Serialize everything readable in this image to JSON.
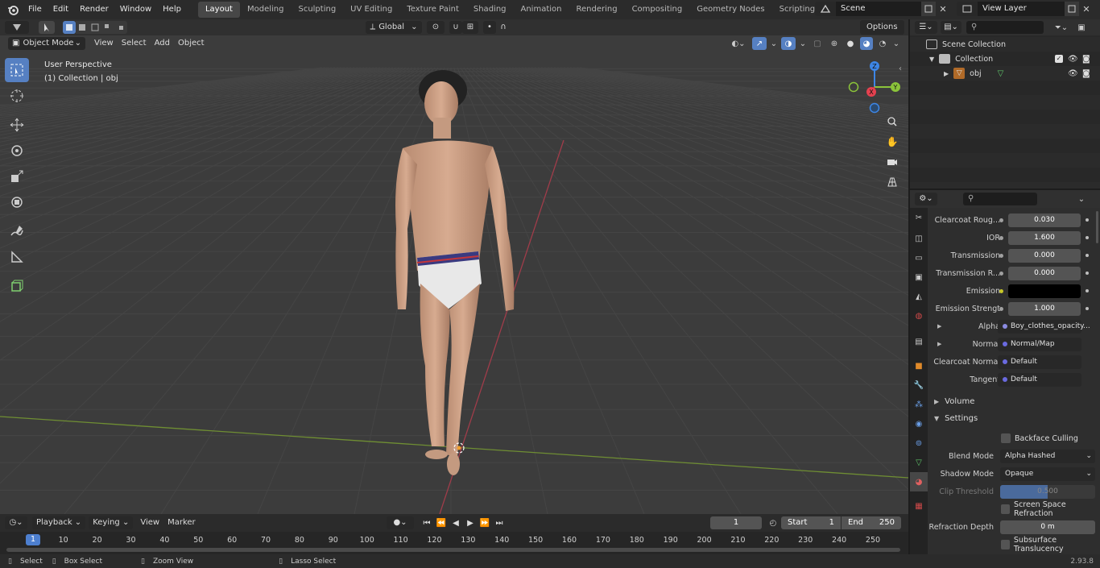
{
  "topbar": {
    "menus": [
      "File",
      "Edit",
      "Render",
      "Window",
      "Help"
    ],
    "workspaces": [
      "Layout",
      "Modeling",
      "Sculpting",
      "UV Editing",
      "Texture Paint",
      "Shading",
      "Animation",
      "Rendering",
      "Compositing",
      "Geometry Nodes",
      "Scripting"
    ],
    "active_workspace": "Layout",
    "scene": "Scene",
    "view_layer": "View Layer"
  },
  "viewport": {
    "mode": "Object Mode",
    "menus": [
      "View",
      "Select",
      "Add",
      "Object"
    ],
    "transform_orientation": "Global",
    "options_label": "Options",
    "overlay_title": "User Perspective",
    "overlay_subtitle": "(1) Collection | obj",
    "gizmo_axes": {
      "z": "Z",
      "y": "Y",
      "x": "X"
    }
  },
  "outliner": {
    "search_placeholder": "",
    "items": [
      {
        "label": "Scene Collection"
      },
      {
        "label": "Collection"
      },
      {
        "label": "obj"
      }
    ]
  },
  "properties": {
    "rows": [
      {
        "label": "Clearcoat Roug...",
        "value": "0.030",
        "type": "num"
      },
      {
        "label": "IOR",
        "value": "1.600",
        "type": "num"
      },
      {
        "label": "Transmission",
        "value": "0.000",
        "type": "num"
      },
      {
        "label": "Transmission R...",
        "value": "0.000",
        "type": "num"
      },
      {
        "label": "Emission",
        "value": "",
        "type": "color"
      },
      {
        "label": "Emission Strengt",
        "value": "1.000",
        "type": "num"
      },
      {
        "label": "Alpha",
        "value": "Boy_clothes_opacity...",
        "type": "link"
      },
      {
        "label": "Normal",
        "value": "Normal/Map",
        "type": "link"
      },
      {
        "label": "Clearcoat Normal",
        "value": "Default",
        "type": "link"
      },
      {
        "label": "Tangent",
        "value": "Default",
        "type": "link"
      }
    ],
    "volume_label": "Volume",
    "settings_label": "Settings",
    "backface_culling": "Backface Culling",
    "blend_mode_label": "Blend Mode",
    "blend_mode_value": "Alpha Hashed",
    "shadow_mode_label": "Shadow Mode",
    "shadow_mode_value": "Opaque",
    "clip_threshold_label": "Clip Threshold",
    "clip_threshold_value": "0.500",
    "clip_threshold_fill": 0.5,
    "ssr_label": "Screen Space Refraction",
    "refraction_depth_label": "Refraction Depth",
    "refraction_depth_value": "0 m",
    "subsurface_label": "Subsurface Translucency"
  },
  "timeline": {
    "menus": [
      "Playback",
      "Keying",
      "View",
      "Marker"
    ],
    "current_frame": "1",
    "start_label": "Start",
    "start_value": "1",
    "end_label": "End",
    "end_value": "250",
    "ticks": [
      "1",
      "10",
      "20",
      "30",
      "40",
      "50",
      "60",
      "70",
      "80",
      "90",
      "100",
      "110",
      "120",
      "130",
      "140",
      "150",
      "160",
      "170",
      "180",
      "190",
      "200",
      "210",
      "220",
      "230",
      "240",
      "250"
    ]
  },
  "statusbar": {
    "select": "Select",
    "box_select": "Box Select",
    "zoom_view": "Zoom View",
    "lasso_select": "Lasso Select",
    "version": "2.93.8"
  },
  "colors": {
    "accent": "#5680c2",
    "active_tab": "#474747",
    "x_axis": "#e5414f",
    "y_axis": "#8bc43a",
    "z_axis": "#3d86e6"
  }
}
